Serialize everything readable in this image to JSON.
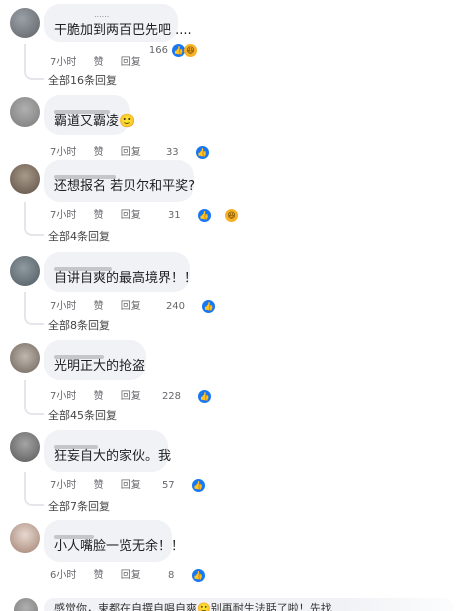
{
  "comments": [
    {
      "top_meta": "......",
      "text": "干脆加到两百巴先吧 ....",
      "time": "7小时",
      "like_label": "赞",
      "reply_label": "回复",
      "reaction_count": "166",
      "reactions": [
        "like",
        "haha"
      ],
      "replies": "全部16条回复"
    },
    {
      "text": "霸道又霸凌🙂",
      "time": "7小时",
      "like_label": "赞",
      "reply_label": "回复",
      "reaction_count": "33",
      "reactions": [
        "like"
      ],
      "replies": ""
    },
    {
      "text": "还想报名 若贝尔和平奖?",
      "time": "7小时",
      "like_label": "赞",
      "reply_label": "回复",
      "reaction_count": "31",
      "reactions": [
        "like",
        "haha"
      ],
      "replies": "全部4条回复"
    },
    {
      "text": "自讲自爽的最高境界！！",
      "time": "7小时",
      "like_label": "赞",
      "reply_label": "回复",
      "reaction_count": "240",
      "reactions": [
        "like"
      ],
      "replies": "全部8条回复"
    },
    {
      "text": "光明正大的抢盗",
      "time": "7小时",
      "like_label": "赞",
      "reply_label": "回复",
      "reaction_count": "228",
      "reactions": [
        "like"
      ],
      "replies": "全部45条回复"
    },
    {
      "text": "狂妄自大的家伙。我",
      "time": "7小时",
      "like_label": "赞",
      "reply_label": "回复",
      "reaction_count": "57",
      "reactions": [
        "like"
      ],
      "replies": "全部7条回复"
    },
    {
      "text": "小人嘴脸一览无余！！",
      "time": "6小时",
      "like_label": "赞",
      "reply_label": "回复",
      "reaction_count": "8",
      "reactions": [
        "like"
      ],
      "replies": ""
    }
  ],
  "partial_bottom_text": "感觉你，束都在自撰自唱自爽🙂别再耐生法聒了啦！先找",
  "icons": {
    "like": "thumbs-up-icon",
    "haha": "laughing-emoji-icon"
  },
  "colors": {
    "like": "#1877f2",
    "haha": "#f7b125",
    "bubble": "#f0f2f5",
    "meta": "#65676b"
  }
}
